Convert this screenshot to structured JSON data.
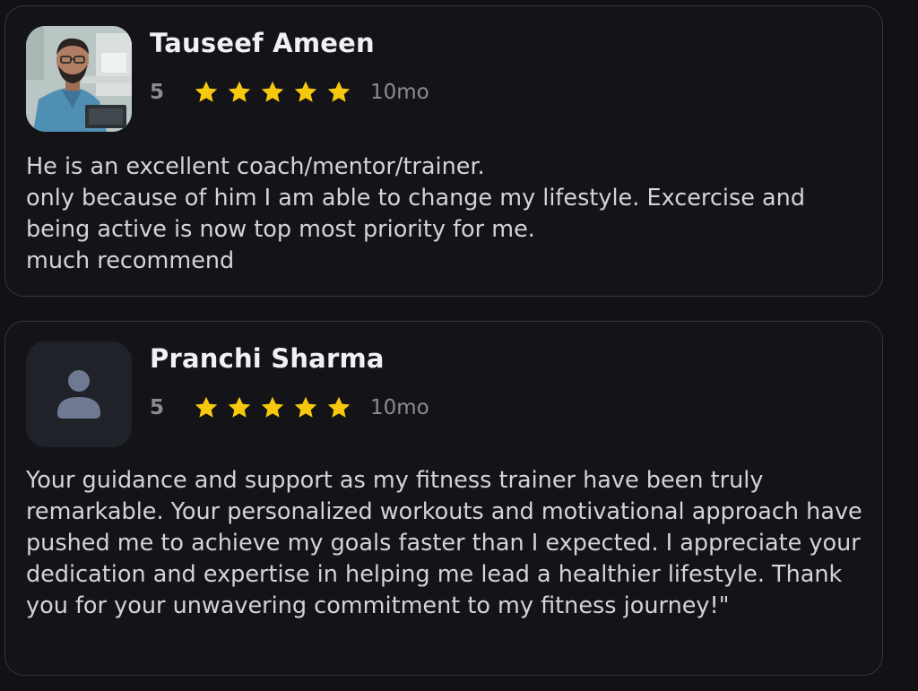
{
  "reviews": [
    {
      "name": "Tauseef Ameen",
      "score": "5",
      "stars": 5,
      "age": "10mo",
      "avatar_icon": "reviewer-photo",
      "text": "He is an excellent coach/mentor/trainer.\nonly because of him I am able to change my lifestyle. Excercise and being active is now top most priority for me.\nmuch recommend"
    },
    {
      "name": "Pranchi Sharma",
      "score": "5",
      "stars": 5,
      "age": "10mo",
      "avatar_icon": "user-placeholder-icon",
      "text": "Your guidance and support as my fitness trainer have been truly remarkable. Your personalized workouts and motivational approach have pushed me to achieve my goals faster than I expected. I appreciate your dedication and expertise in helping me lead a healthier lifestyle. Thank you for your unwavering commitment to my fitness journey!\""
    }
  ],
  "colors": {
    "background": "#121115",
    "card_border": "#35353c",
    "star": "#f6c90e",
    "muted_text": "#8c8c96"
  }
}
